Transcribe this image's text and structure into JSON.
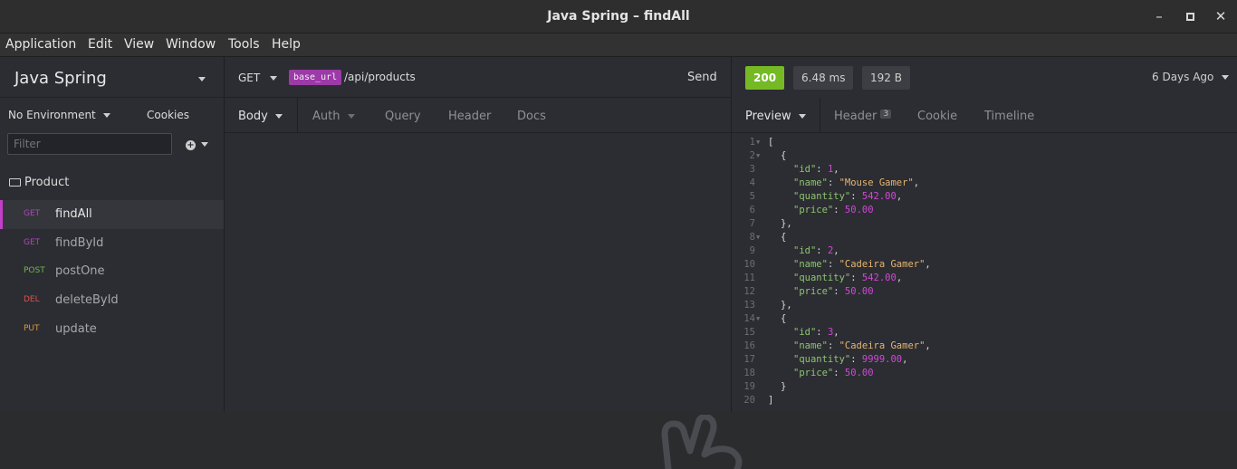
{
  "window": {
    "title": "Java Spring – findAll"
  },
  "menu": [
    "Application",
    "Edit",
    "View",
    "Window",
    "Tools",
    "Help"
  ],
  "sidebar": {
    "workspace": "Java Spring",
    "environment": "No Environment",
    "cookies": "Cookies",
    "filter_placeholder": "Filter",
    "folder": "Product",
    "requests": [
      {
        "method": "GET",
        "name": "findAll",
        "color": "#b044c0",
        "active": true
      },
      {
        "method": "GET",
        "name": "findById",
        "color": "#b044c0",
        "active": false
      },
      {
        "method": "POST",
        "name": "postOne",
        "color": "#6dba4a",
        "active": false
      },
      {
        "method": "DEL",
        "name": "deleteById",
        "color": "#d9534f",
        "active": false
      },
      {
        "method": "PUT",
        "name": "update",
        "color": "#d99a3a",
        "active": false
      }
    ]
  },
  "request": {
    "method": "GET",
    "env_tag": "base_url",
    "path": "/api/products",
    "send": "Send",
    "tabs": [
      "Body",
      "Auth",
      "Query",
      "Header",
      "Docs"
    ]
  },
  "response": {
    "status": "200",
    "time": "6.48 ms",
    "size": "192 B",
    "age": "6 Days Ago",
    "tabs": [
      "Preview",
      "Header",
      "Cookie",
      "Timeline"
    ],
    "header_count": "3",
    "lines": [
      {
        "n": "1",
        "fold": true,
        "indent": 0,
        "parts": [
          [
            "p",
            "["
          ]
        ]
      },
      {
        "n": "2",
        "fold": true,
        "indent": 1,
        "parts": [
          [
            "p",
            "{"
          ]
        ]
      },
      {
        "n": "3",
        "indent": 2,
        "parts": [
          [
            "k",
            "\"id\""
          ],
          [
            "p",
            ": "
          ],
          [
            "v",
            "1"
          ],
          [
            "p",
            ","
          ]
        ]
      },
      {
        "n": "4",
        "indent": 2,
        "parts": [
          [
            "k",
            "\"name\""
          ],
          [
            "p",
            ": "
          ],
          [
            "s",
            "\"Mouse Gamer\""
          ],
          [
            "p",
            ","
          ]
        ]
      },
      {
        "n": "5",
        "indent": 2,
        "parts": [
          [
            "k",
            "\"quantity\""
          ],
          [
            "p",
            ": "
          ],
          [
            "v",
            "542.00"
          ],
          [
            "p",
            ","
          ]
        ]
      },
      {
        "n": "6",
        "indent": 2,
        "parts": [
          [
            "k",
            "\"price\""
          ],
          [
            "p",
            ": "
          ],
          [
            "v",
            "50.00"
          ]
        ]
      },
      {
        "n": "7",
        "indent": 1,
        "parts": [
          [
            "p",
            "},"
          ]
        ]
      },
      {
        "n": "8",
        "fold": true,
        "indent": 1,
        "parts": [
          [
            "p",
            "{"
          ]
        ]
      },
      {
        "n": "9",
        "indent": 2,
        "parts": [
          [
            "k",
            "\"id\""
          ],
          [
            "p",
            ": "
          ],
          [
            "v",
            "2"
          ],
          [
            "p",
            ","
          ]
        ]
      },
      {
        "n": "10",
        "indent": 2,
        "parts": [
          [
            "k",
            "\"name\""
          ],
          [
            "p",
            ": "
          ],
          [
            "s",
            "\"Cadeira Gamer\""
          ],
          [
            "p",
            ","
          ]
        ]
      },
      {
        "n": "11",
        "indent": 2,
        "parts": [
          [
            "k",
            "\"quantity\""
          ],
          [
            "p",
            ": "
          ],
          [
            "v",
            "542.00"
          ],
          [
            "p",
            ","
          ]
        ]
      },
      {
        "n": "12",
        "indent": 2,
        "parts": [
          [
            "k",
            "\"price\""
          ],
          [
            "p",
            ": "
          ],
          [
            "v",
            "50.00"
          ]
        ]
      },
      {
        "n": "13",
        "indent": 1,
        "parts": [
          [
            "p",
            "},"
          ]
        ]
      },
      {
        "n": "14",
        "fold": true,
        "indent": 1,
        "parts": [
          [
            "p",
            "{"
          ]
        ]
      },
      {
        "n": "15",
        "indent": 2,
        "parts": [
          [
            "k",
            "\"id\""
          ],
          [
            "p",
            ": "
          ],
          [
            "v",
            "3"
          ],
          [
            "p",
            ","
          ]
        ]
      },
      {
        "n": "16",
        "indent": 2,
        "parts": [
          [
            "k",
            "\"name\""
          ],
          [
            "p",
            ": "
          ],
          [
            "s",
            "\"Cadeira Gamer\""
          ],
          [
            "p",
            ","
          ]
        ]
      },
      {
        "n": "17",
        "indent": 2,
        "parts": [
          [
            "k",
            "\"quantity\""
          ],
          [
            "p",
            ": "
          ],
          [
            "v",
            "9999.00"
          ],
          [
            "p",
            ","
          ]
        ]
      },
      {
        "n": "18",
        "indent": 2,
        "parts": [
          [
            "k",
            "\"price\""
          ],
          [
            "p",
            ": "
          ],
          [
            "v",
            "50.00"
          ]
        ]
      },
      {
        "n": "19",
        "indent": 1,
        "parts": [
          [
            "p",
            "}"
          ]
        ]
      },
      {
        "n": "20",
        "indent": 0,
        "parts": [
          [
            "p",
            "]"
          ]
        ]
      }
    ]
  },
  "colors": {
    "accent": "#c33fc8",
    "status_ok": "#75ba24"
  }
}
